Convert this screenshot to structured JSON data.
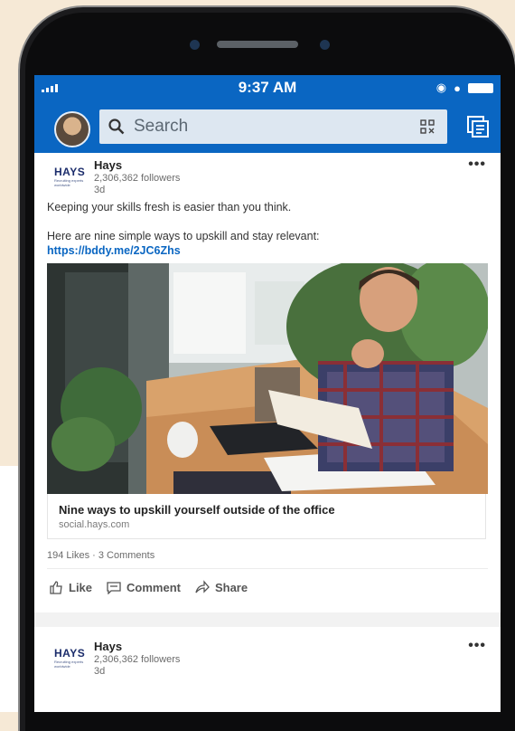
{
  "status": {
    "time": "9:37 AM"
  },
  "navbar": {
    "search_placeholder": "Search"
  },
  "post1": {
    "logo_text": "HAYS",
    "logo_tag": "Recruiting experts worldwide",
    "author": "Hays",
    "followers": "2,306,362 followers",
    "age": "3d",
    "more": "•••",
    "text1": "Keeping your skills fresh is easier than you think.",
    "text2": "Here are nine simple ways to upskill and stay relevant:",
    "link": "https://bddy.me/2JC6Zhs",
    "link_title": "Nine ways to upskill yourself outside of the office",
    "link_domain": "social.hays.com",
    "counts": "194 Likes · 3 Comments",
    "actions": {
      "like": "Like",
      "comment": "Comment",
      "share": "Share"
    }
  },
  "post2": {
    "logo_text": "HAYS",
    "logo_tag": "Recruiting experts worldwide",
    "author": "Hays",
    "followers": "2,306,362 followers",
    "age": "3d",
    "more": "•••"
  },
  "colors": {
    "brand": "#0a66c2",
    "background": "#f6e9d6"
  }
}
